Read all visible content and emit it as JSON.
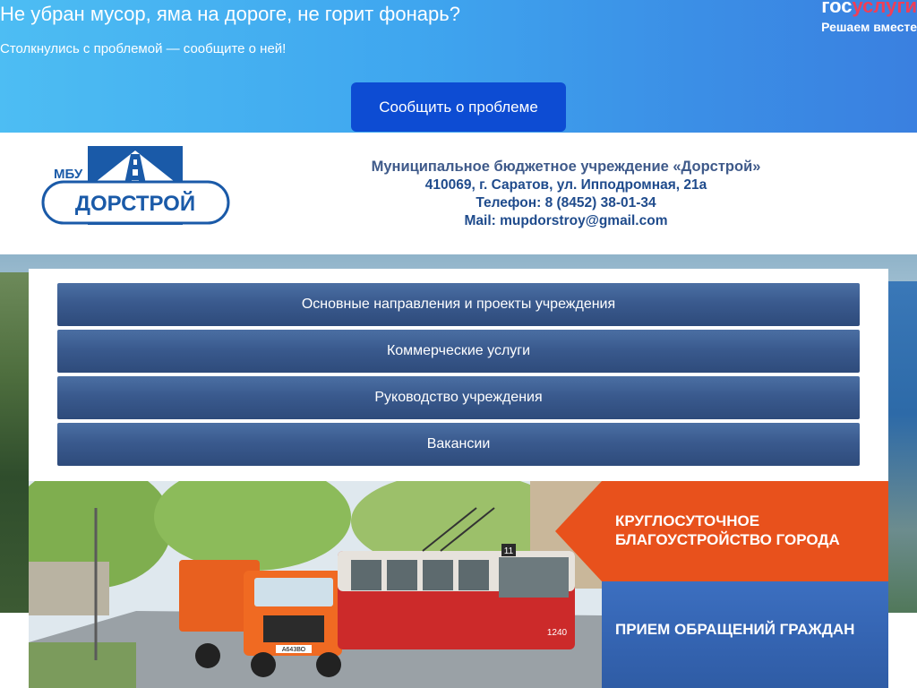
{
  "banner": {
    "title": "Не убран мусор, яма на дороге, не горит фонарь?",
    "subtitle": "Столкнулись с проблемой — сообщите о ней!",
    "button_label": "Сообщить о проблеме",
    "logo_part1": "гос",
    "logo_part2": "услуги",
    "tagline": "Решаем вместе"
  },
  "header": {
    "logo_small_text": "МБУ",
    "logo_big_text": "ДОРСТРОЙ",
    "org_name": "Муниципальное бюджетное учреждение «Дорстрой»",
    "address": "410069, г. Саратов, ул. Ипподромная, 21а",
    "phone": "Телефон: 8 (8452) 38-01-34",
    "email": "Mail: mupdorstroy@gmail.com"
  },
  "menu": {
    "items": [
      {
        "label": "Основные направления и проекты учреждения"
      },
      {
        "label": "Коммерческие услуги"
      },
      {
        "label": "Руководство учреждения"
      },
      {
        "label": "Вакансии"
      }
    ]
  },
  "promo": {
    "orange_label": "КРУГЛОСУТОЧНОЕ БЛАГОУСТРОЙСТВО ГОРОДА",
    "blue_label": "ПРИЕМ ОБРАЩЕНИЙ ГРАЖДАН",
    "truck_plate": "А643ВО",
    "tram_number": "11",
    "tram_fleet_number": "1240"
  },
  "colors": {
    "banner_blue": "#3fa6ef",
    "button_blue": "#0d4cd3",
    "gos_red": "#ee3f58",
    "menu_blue": "#3a5a8e",
    "promo_orange": "#e8511c",
    "promo_blue": "#3565b3",
    "logo_blue": "#1a5aa8"
  }
}
